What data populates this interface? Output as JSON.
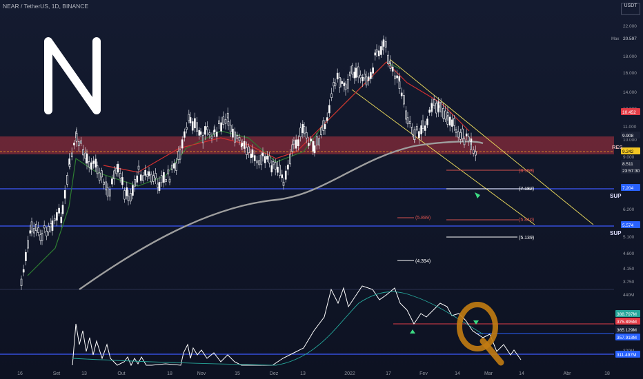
{
  "header": {
    "symbol": "NEAR / TetherUS, 1D, BINANCE",
    "currency_line1": "",
    "currency_line2": "USDT"
  },
  "price_axis": {
    "labels": [
      "22.000",
      "18.000",
      "16.000",
      "14.000",
      "12.000",
      "11.000",
      "10.000",
      "9.000",
      "8.000",
      "7.000",
      "6.200",
      "5.100",
      "4.600",
      "4.150",
      "3.750"
    ],
    "max_label": "Max",
    "max_value": "20.597",
    "tags": [
      {
        "value": "10.452",
        "color": "#e33d48"
      },
      {
        "value": "9.908",
        "color": "#1b2135"
      },
      {
        "value": "9.242",
        "color": "#f2c623"
      },
      {
        "value": "8.511",
        "color": "#1b2135"
      },
      {
        "value": "23:57:30",
        "color": "#1b2135"
      },
      {
        "value": "7.204",
        "color": "#2962ff"
      },
      {
        "value": "5.574",
        "color": "#2962ff"
      }
    ]
  },
  "zones": {
    "resistance_label": "RES",
    "support_label": "SUP"
  },
  "levels": [
    {
      "label": "(8.153)",
      "color": "#d9534f"
    },
    {
      "label": "(7.182)",
      "color": "#ffffff"
    },
    {
      "label": "(5.899)",
      "color": "#d9534f"
    },
    {
      "label": "(5.840)",
      "color": "#d9534f"
    },
    {
      "label": "(5.139)",
      "color": "#ffffff"
    },
    {
      "label": "(4.394)",
      "color": "#ffffff"
    }
  ],
  "oscillator_axis": {
    "labels": [
      "440M",
      "320M"
    ],
    "tags": [
      {
        "value": "388.797M",
        "color": "#26a69a"
      },
      {
        "value": "375.895M",
        "color": "#e33d48"
      },
      {
        "value": "365.129M",
        "color": "#d1d4dc"
      },
      {
        "value": "357.918M",
        "color": "#2962ff"
      },
      {
        "value": "311.497M",
        "color": "#2962ff"
      }
    ]
  },
  "time_axis": [
    "16",
    "Set",
    "13",
    "Out",
    "18",
    "Nov",
    "15",
    "Dez",
    "13",
    "2022",
    "17",
    "Fev",
    "14",
    "Mar",
    "14",
    "Abr",
    "18"
  ],
  "colors": {
    "bg": "#101629",
    "candle": "#d1d4dc",
    "resistance_zone": "#b2333f",
    "support_line": "#3d5afe",
    "channel": "#e2d15a",
    "ema_fast": "#d32f2f",
    "ema_green": "#2e7d32",
    "ma_gray": "#9e9e9e",
    "osc_line": "#ffffff",
    "osc_signal": "#26a69a",
    "logo": "#ffffff",
    "q_mark": "#c27c12"
  },
  "icons": {
    "logo": "near-logo-icon",
    "annotation": "q-annotation-icon"
  }
}
